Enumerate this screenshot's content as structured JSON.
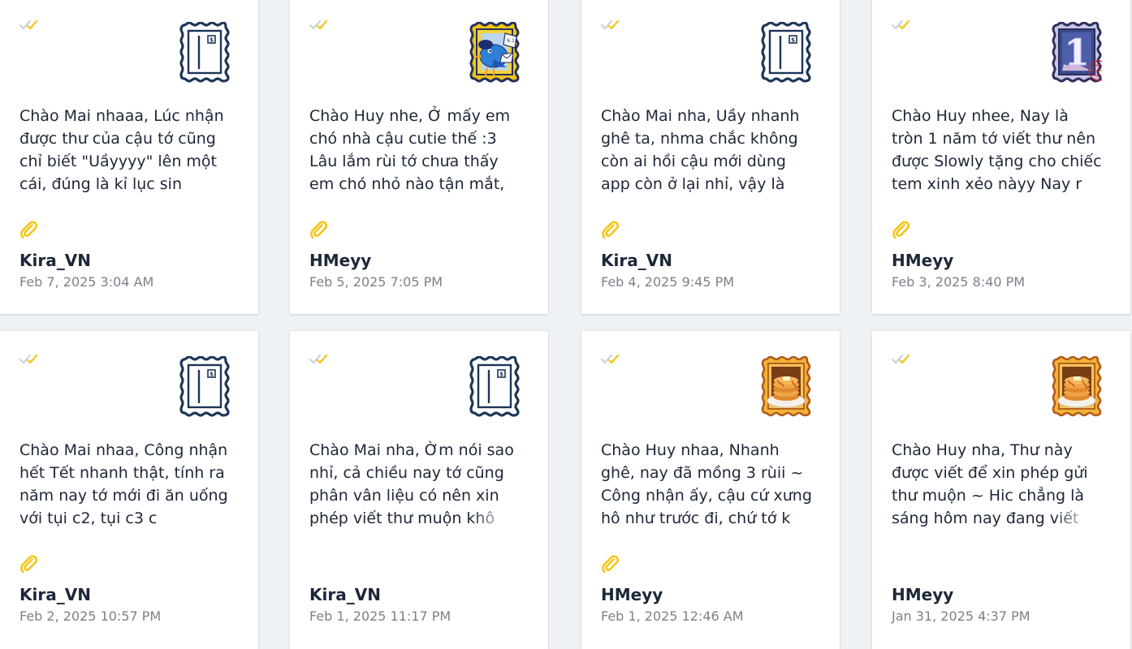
{
  "letters": [
    {
      "message": "Chào Mai nhaaa, Lúc nhận được thư của cậu tớ cũng chỉ biết \"Uầyyyy\" lên một cái, đúng là kỉ lục sin",
      "sender": "Kira_VN",
      "date": "Feb 7, 2025 3:04 AM",
      "stamp": "default-letter-stamp-icon",
      "has_attachment": true
    },
    {
      "message": "Chào Huy nhe, Ở mấy em chó nhà cậu cutie thế :3 Lâu lắm rùi tớ chưa thấy em chó nhỏ nào tận mắt, tạ",
      "sender": "HMeyy",
      "date": "Feb 5, 2025 7:05 PM",
      "stamp": "bluebird-mail-stamp-icon",
      "has_attachment": true
    },
    {
      "message": "Chào Mai nha, Uầy nhanh ghê ta, nhma chắc không còn ai hồi cậu mới dùng app còn ở lại nhỉ, vậy là",
      "sender": "Kira_VN",
      "date": "Feb 4, 2025 9:45 PM",
      "stamp": "default-letter-stamp-icon",
      "has_attachment": true
    },
    {
      "message": "Chào Huy nhee, Nay là tròn 1 năm tớ viết thư nên được Slowly tặng cho chiếc tem xinh xẻo nàyy Nay r",
      "sender": "HMeyy",
      "date": "Feb 3, 2025 8:40 PM",
      "stamp": "anniversary-one-stamp-icon",
      "has_attachment": true
    },
    {
      "message": "Chào Mai nhaa, Công nhận hết Tết nhanh thật, tính ra năm nay tớ mới đi ăn uống với tụi c2, tụi c3 c",
      "sender": "Kira_VN",
      "date": "Feb 2, 2025 10:57 PM",
      "stamp": "default-letter-stamp-icon",
      "has_attachment": true
    },
    {
      "message": "Chào Mai nha, Ờm nói sao nhỉ, cả chiều nay tớ cũng phân vân liệu có nên xin phép viết thư muộn khô",
      "sender": "Kira_VN",
      "date": "Feb 1, 2025 11:17 PM",
      "stamp": "default-letter-stamp-icon",
      "has_attachment": false
    },
    {
      "message": "Chào Huy nhaa, Nhanh ghê, nay đã mồng 3 rùii ~ Công nhận ấy, cậu cứ xưng hô như trước đi, chứ tớ k",
      "sender": "HMeyy",
      "date": "Feb 1, 2025 12:46 AM",
      "stamp": "pancake-stamp-icon",
      "has_attachment": true
    },
    {
      "message": "Chào Huy nha, Thư này được viết để xin phép gửi thư muộn ~ Hic chẳng là sáng hôm nay đang viết",
      "sender": "HMeyy",
      "date": "Jan 31, 2025 4:37 PM",
      "stamp": "pancake-stamp-icon",
      "has_attachment": false
    }
  ],
  "colors": {
    "navy": "#1d3557",
    "accent_yellow": "#f5c518",
    "check_grey": "#c9ced6",
    "text": "#1d2738",
    "muted": "#7b818a"
  }
}
